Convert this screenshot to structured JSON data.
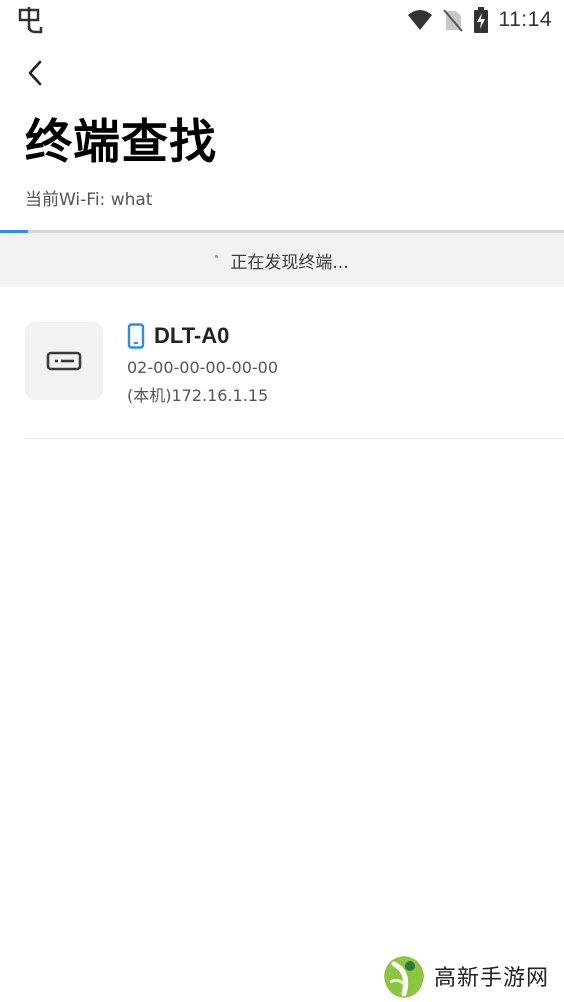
{
  "status_bar": {
    "time": "11:14",
    "app_icon": "bug-icon",
    "icons": [
      "wifi-icon",
      "no-sim-icon",
      "battery-charging-icon"
    ]
  },
  "header": {
    "back_icon": "chevron-left-icon",
    "title": "终端查找",
    "wifi_label": "当前Wi-Fi: what"
  },
  "scan": {
    "progress": 0.05,
    "status_text": "正在发现终端...",
    "accent_color": "#2a8ee8"
  },
  "devices": [
    {
      "type_icon": "router-icon",
      "device_icon": "phone-icon",
      "name": "DLT-A0",
      "mac": "02-00-00-00-00-00",
      "ip": "(本机)172.16.1.15"
    }
  ],
  "watermark": {
    "logo": "leaf-logo",
    "text": "高新手游网"
  }
}
